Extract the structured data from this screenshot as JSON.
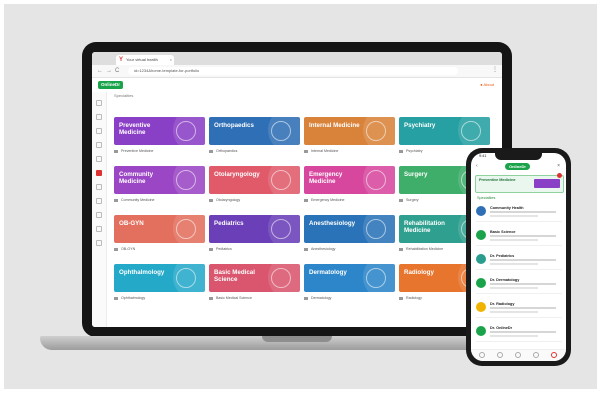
{
  "browser": {
    "tab_title": "Your virtual health",
    "tab_logo_glyph": "Y",
    "url": "id=1234&home-template-for-portfolio",
    "nav_back": "←",
    "nav_forward": "→",
    "nav_reload": "C",
    "menu": "⋮"
  },
  "app": {
    "brand": "OnlineDr",
    "header_action": "● About",
    "section_label": "Specialties",
    "accent_color": "#1aa34a",
    "tiles": [
      {
        "name": "Preventive Medicine",
        "meta": "Preventive Medicine",
        "color": "#8a3fc7",
        "icon": "head-icon"
      },
      {
        "name": "Orthopaedics",
        "meta": "Orthopaedics",
        "color": "#2f6fb6",
        "icon": "bone-icon"
      },
      {
        "name": "Internal Medicine",
        "meta": "Internal Medicine",
        "color": "#d9833a",
        "icon": "lungs-icon"
      },
      {
        "name": "Psychiatry",
        "meta": "Psychiatry",
        "color": "#26a0a2",
        "icon": "brain-icon"
      },
      {
        "name": "Community Medicine",
        "meta": "Community Medicine",
        "color": "#9b46c4",
        "icon": "community-icon"
      },
      {
        "name": "Otolaryngology",
        "meta": "Otolaryngology",
        "color": "#e05a6a",
        "icon": "ear-icon"
      },
      {
        "name": "Emergency Medicine",
        "meta": "Emergency Medicine",
        "color": "#d8479e",
        "icon": "ambulance-icon"
      },
      {
        "name": "Surgery",
        "meta": "Surgery",
        "color": "#3fae6a",
        "icon": "scalpel-icon"
      },
      {
        "name": "OB-GYN",
        "meta": "OB-GYN",
        "color": "#e3705f",
        "icon": "uterus-icon"
      },
      {
        "name": "Pediatrics",
        "meta": "Pediatrics",
        "color": "#6a3fb8",
        "icon": "baby-icon"
      },
      {
        "name": "Anesthesiology",
        "meta": "Anesthesiology",
        "color": "#2a73b8",
        "icon": "syringe-icon"
      },
      {
        "name": "Rehabilitation Medicine",
        "meta": "Rehabilitation Medicine",
        "color": "#2fa08f",
        "icon": "wheelchair-icon"
      },
      {
        "name": "Ophthalmology",
        "meta": "Ophthalmology",
        "color": "#25a9c9",
        "icon": "eye-icon"
      },
      {
        "name": "Basic Medical Science",
        "meta": "Basic Medical Science",
        "color": "#d9566e",
        "icon": "dna-icon"
      },
      {
        "name": "Dermatology",
        "meta": "Dermatology",
        "color": "#2c86c9",
        "icon": "skin-icon"
      },
      {
        "name": "Radiology",
        "meta": "Radiology",
        "color": "#e8752e",
        "icon": "xray-icon"
      }
    ]
  },
  "phone": {
    "time": "9:41",
    "brand": "OnlineDr",
    "back": "‹",
    "close": "×",
    "banner_text": "Preventive Medicine",
    "section_label": "Specialties",
    "items": [
      {
        "title": "Community Health",
        "color": "#2f6fb6"
      },
      {
        "title": "Basic Science",
        "color": "#1aa34a"
      },
      {
        "title": "Dr. Pediatrics",
        "color": "#2a9d8f"
      },
      {
        "title": "Dr. Dermatology",
        "color": "#1aa34a"
      },
      {
        "title": "Dr. Radiology",
        "color": "#f0b400"
      },
      {
        "title": "Dr. OnlineDr",
        "color": "#1aa34a"
      }
    ]
  }
}
